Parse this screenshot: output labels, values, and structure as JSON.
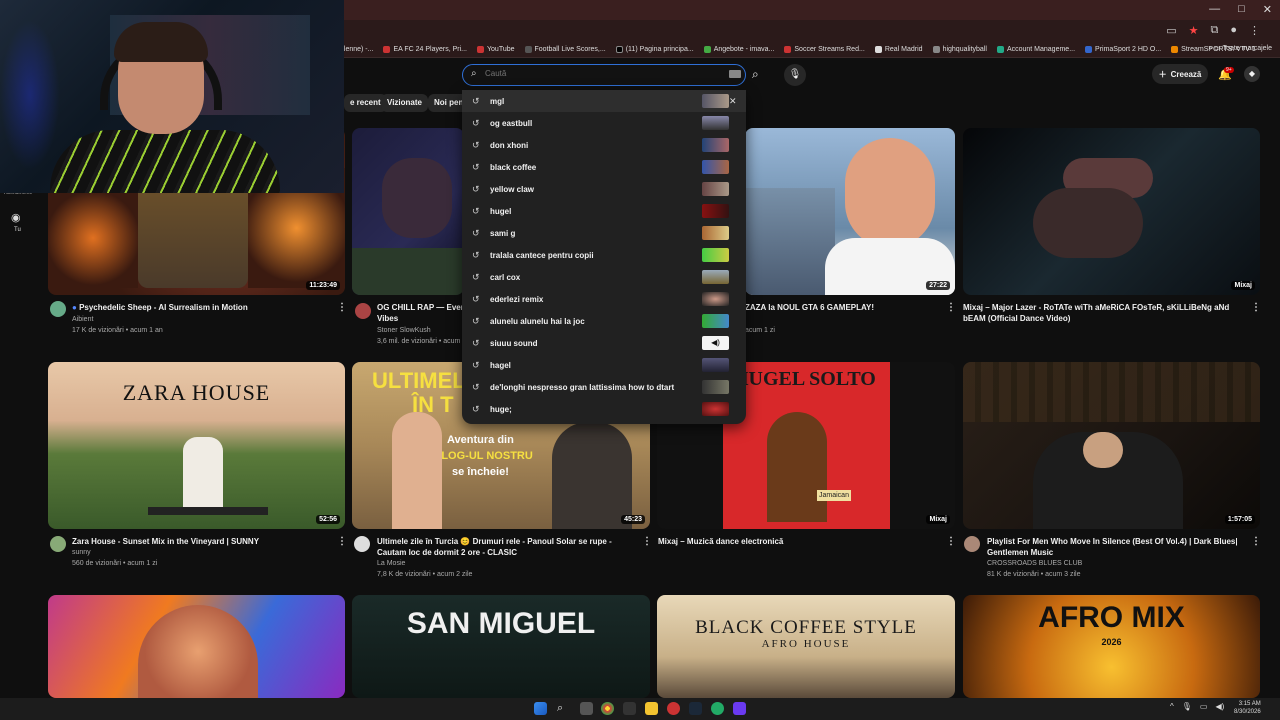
{
  "bookmarks": [
    "elenne) -...",
    "EA FC 24 Players, Pri...",
    "YouTube",
    "Football Live Scores,...",
    "(11) Pagina principa...",
    "Angebote - imava...",
    "Soccer Streams Red...",
    "Real Madrid",
    "highqualityball",
    "Account Manageme...",
    "PrimaSport 2 HD O...",
    "StreamSPORTS: VTV 1"
  ],
  "bookmarks_all": "Toate marcajele",
  "search": {
    "placeholder": "Caută"
  },
  "header": {
    "create_label": "Creează",
    "notif_badge": "9+"
  },
  "chips": [
    "e recent",
    "Vizionate",
    "Noi pent"
  ],
  "sidebar": {
    "subscriptions_label": "Abonamente",
    "you_label": "Tu"
  },
  "suggestions": [
    "mgl",
    "og eastbull",
    "don xhoni",
    "black coffee",
    "yellow claw",
    "hugel",
    "sami g",
    "tralala cantece pentru copii",
    "carl cox",
    "ederlezi remix",
    "alunelu alunelu hai la joc",
    "siuuu sound",
    "hagel",
    "de'longhi nespresso gran lattissima how to dtart",
    "huge;"
  ],
  "videos": [
    {
      "title": "Psychedelic Sheep - AI Surrealism in Motion",
      "channel": "Aibient",
      "meta": "17 K de vizionări • acum 1 an",
      "duration": "11:23:49"
    },
    {
      "title": "OG CHILL RAP — Everyo",
      "title2": "Vibes",
      "channel": "Stoner SlowKush",
      "meta": "3,6 mil. de vizionări • acum",
      "duration": ""
    },
    {
      "title": "ZAZA la NOUL GTA 6 GAMEPLAY!",
      "channel": "",
      "meta": "acum 1 zi",
      "duration": "27:22"
    },
    {
      "title": "Mixaj – Major Lazer - RoTATe wiTh aMeRiCA FOsTeR, sKiLLiBeNg aNd bEAM (Official Dance Video)",
      "channel": "",
      "meta": "",
      "duration": "Mixaj"
    },
    {
      "title": "Zara House - Sunset Mix in the Vineyard | SUNNY",
      "channel": "sunny",
      "meta": "560 de vizionări • acum 1 zi",
      "duration": "52:56"
    },
    {
      "title": "Ultimele zile în Turcia 😊 Drumuri rele - Panoul Solar se rupe - Cautam loc de dormit 2 ore - CLASIC",
      "channel": "La Mosie",
      "meta": "7,8 K de vizionări • acum 2 zile",
      "duration": "45:23"
    },
    {
      "title": "Mixaj – Muzică dance electronică",
      "channel": "",
      "meta": "",
      "duration": "Mixaj"
    },
    {
      "title": "Playlist For Men Who Move In Silence (Best Of Vol.4) | Dark Blues| Gentlemen Music",
      "channel": "CROSSROADS BLUES CLUB",
      "meta": "81 K de vizionări • acum 3 zile",
      "duration": "1:57:05"
    }
  ],
  "thumb_texts": {
    "zara": "ZARA HOUSE",
    "ultimele": "ULTIMELE",
    "ultimele2": "ÎN T",
    "aventura": "Aventura din",
    "vlog": "VLOG-UL NOSTRU",
    "incheie": "se încheie!",
    "hugel": "HUGEL SOLTO",
    "jamaican": "Jamaican",
    "sanmiguel": "SAN MIGUEL",
    "blackcoffee": "BLACK COFFEE STYLE",
    "afrohouse": "AFRO HOUSE",
    "afromix": "AFRO MIX",
    "year": "2026"
  },
  "clock": {
    "time": "3:15 AM",
    "date": "8/30/2026"
  },
  "colors": {
    "accent_red": "#cc0000",
    "search_border": "#2f6fd6"
  }
}
